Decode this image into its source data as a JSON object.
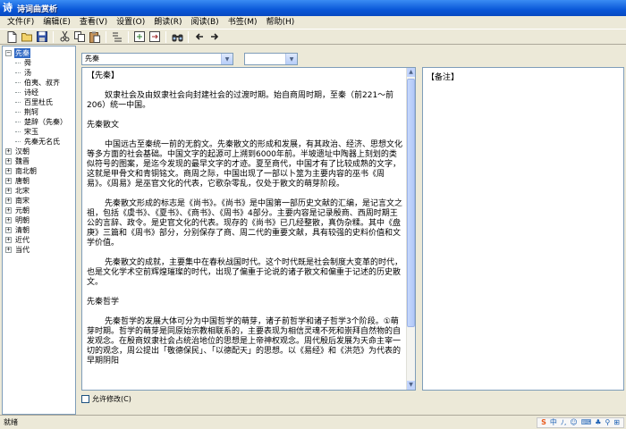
{
  "window": {
    "title": "诗词曲赏析",
    "app_icon_glyph": "诗"
  },
  "menu": [
    {
      "label": "文件(F)"
    },
    {
      "label": "编辑(E)"
    },
    {
      "label": "查看(V)"
    },
    {
      "label": "设置(O)"
    },
    {
      "label": "朗读(R)"
    },
    {
      "label": "阅读(B)"
    },
    {
      "label": "书签(M)"
    },
    {
      "label": "帮助(H)"
    }
  ],
  "toolbar_icons": [
    "new-document-icon",
    "open-folder-icon",
    "save-icon",
    "cut-icon",
    "copy-icon",
    "paste-icon",
    "format-icon",
    "import-icon",
    "export-icon",
    "find-icon",
    "back-arrow-icon",
    "forward-arrow-icon"
  ],
  "tree": {
    "items": [
      {
        "label": "先秦",
        "selected": true,
        "expanded": true,
        "level": 0
      },
      {
        "label": "舜",
        "level": 1
      },
      {
        "label": "汤",
        "level": 1
      },
      {
        "label": "伯夷、叔齐",
        "level": 1
      },
      {
        "label": "诗经",
        "level": 1
      },
      {
        "label": "百里杜氏",
        "level": 1
      },
      {
        "label": "荆轲",
        "level": 1
      },
      {
        "label": "楚辞（先秦）",
        "level": 1
      },
      {
        "label": "宋玉",
        "level": 1
      },
      {
        "label": "先秦无名氏",
        "level": 1
      },
      {
        "label": "汉朝",
        "level": 0
      },
      {
        "label": "魏晋",
        "level": 0
      },
      {
        "label": "南北朝",
        "level": 0
      },
      {
        "label": "唐朝",
        "level": 0
      },
      {
        "label": "北宋",
        "level": 0
      },
      {
        "label": "南宋",
        "level": 0
      },
      {
        "label": "元朝",
        "level": 0
      },
      {
        "label": "明朝",
        "level": 0
      },
      {
        "label": "清朝",
        "level": 0
      },
      {
        "label": "近代",
        "level": 0
      },
      {
        "label": "当代",
        "level": 0
      }
    ]
  },
  "combo_dynasty": {
    "value": "先秦"
  },
  "combo_second": {
    "value": ""
  },
  "reading": {
    "blocks": [
      {
        "type": "heading",
        "text": "【先秦】"
      },
      {
        "type": "para",
        "text": "奴隶社会及由奴隶社会向封建社会的过渡时期。始自商周时期，至秦（前221～前206）统一中国。"
      },
      {
        "type": "heading",
        "text": "先秦散文"
      },
      {
        "type": "para",
        "text": "中国远古至秦统一前的无韵文。先秦散文的形成和发展，有其政治、经济、思想文化等多方面的社会基础。中国文字的起源可上溯到6000年前。半坡遗址中陶器上刻划的类似符号的图案，是迄今发现的最早文字的才迹。夏至商代，中国才有了比较成熟的文字，这就是甲骨文和青铜铭文。商周之际，中国出现了一部以卜筮为主要内容的巫书《周易》。《周易》是巫官文化的代表，它歌杂零乱，仅处于散文的萌芽阶段。"
      },
      {
        "type": "para",
        "text": "先秦散文形成的标志是《尚书》。《尚书》是中国第一部历史文献的汇编，是记言文之祖，包括《虞书》、《夏书》、《商书》、《周书》4部分。主要内容是记录殷商、西周时期王公的言辞、政令。是史官文化的代表。现存的《尚书》已几经整散，真伪杂糅。其中《盘庚》三篇和《周书》部分，分别保存了商、周二代的重要文献，具有较强的史料价值和文学价值。"
      },
      {
        "type": "para",
        "text": "先秦散文的成就，主要集中在春秋战国时代。这个时代既是社会制度大变革的时代，也是文化学术空前辉煌璀璨的时代，出现了偏重于论说的诸子散文和偏重于记述的历史散文。"
      },
      {
        "type": "heading",
        "text": "先秦哲学"
      },
      {
        "type": "para",
        "text": "先秦哲学的发展大体可分为中国哲学的萌芽，诸子前哲学和诸子哲学3个阶段。①萌芽时期。哲学的萌芽是同原始宗教相联系的，主要表现为相信灵魂不死和崇拜自然物的自发观念。在殷商奴隶社会占统治地位的思想是上帝神权观念。周代殷后发展为天命主宰一切的观念，周公提出「敬德保民」、「以德配天」的思想。以《易经》和《洪范》为代表的早期阴阳"
      }
    ]
  },
  "notes": {
    "title": "【备注】"
  },
  "allow_edit": {
    "label": "允许修改(C)",
    "checked": false
  },
  "status": {
    "text": "就绪"
  },
  "ime": [
    "S",
    "中",
    "ﾉ,",
    "☺",
    "⌨",
    "♣",
    "⚲",
    "⊞"
  ]
}
